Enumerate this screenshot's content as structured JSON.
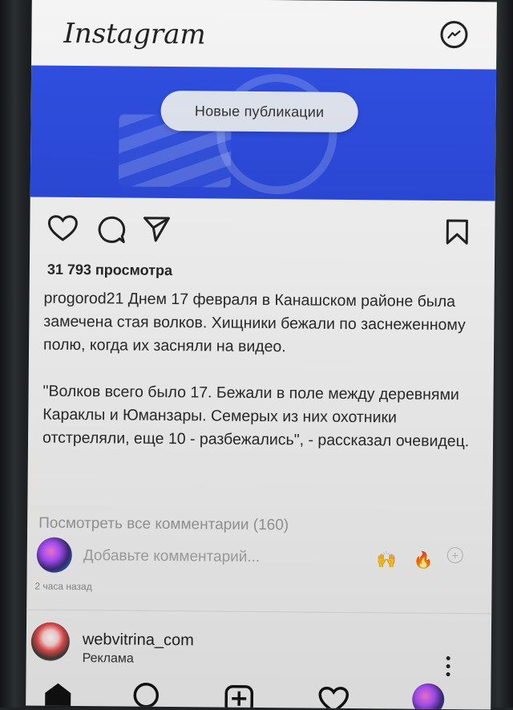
{
  "app": {
    "title": "Instagram"
  },
  "banner": {
    "new_posts_label": "Новые публикации"
  },
  "post": {
    "views": "31 793 просмотра",
    "username": "progorod21",
    "caption_first": "Днем 17 февраля в Канашском районе была замечена стая волков. Хищники бежали по заснеженному полю, когда их засняли на видео.",
    "caption_quote": "\"Волков всего было 17. Бежали в поле между деревнями Караклы и Юманзары. Семерых из них охотники отстреляли, еще 10 - разбежались\", - рассказал очевидец.",
    "view_comments": "Посмотреть все комментарии (160)",
    "add_comment_placeholder": "Добавьте комментарий...",
    "quick_emojis": [
      "🙌",
      "🔥"
    ],
    "time": "2 часа назад"
  },
  "next_post": {
    "username": "webvitrina_com",
    "label": "Реклама"
  },
  "icons": {
    "like": "heart-icon",
    "comment": "comment-icon",
    "share": "send-icon",
    "save": "bookmark-icon",
    "messenger": "messenger-icon",
    "more": "more-vertical-icon",
    "nav": [
      "home-icon",
      "search-icon",
      "add-post-icon",
      "activity-heart-icon",
      "profile-avatar-icon"
    ]
  },
  "colors": {
    "banner": "#2f4fe0",
    "text": "#2a2a2a",
    "muted": "#9a9a9a"
  }
}
